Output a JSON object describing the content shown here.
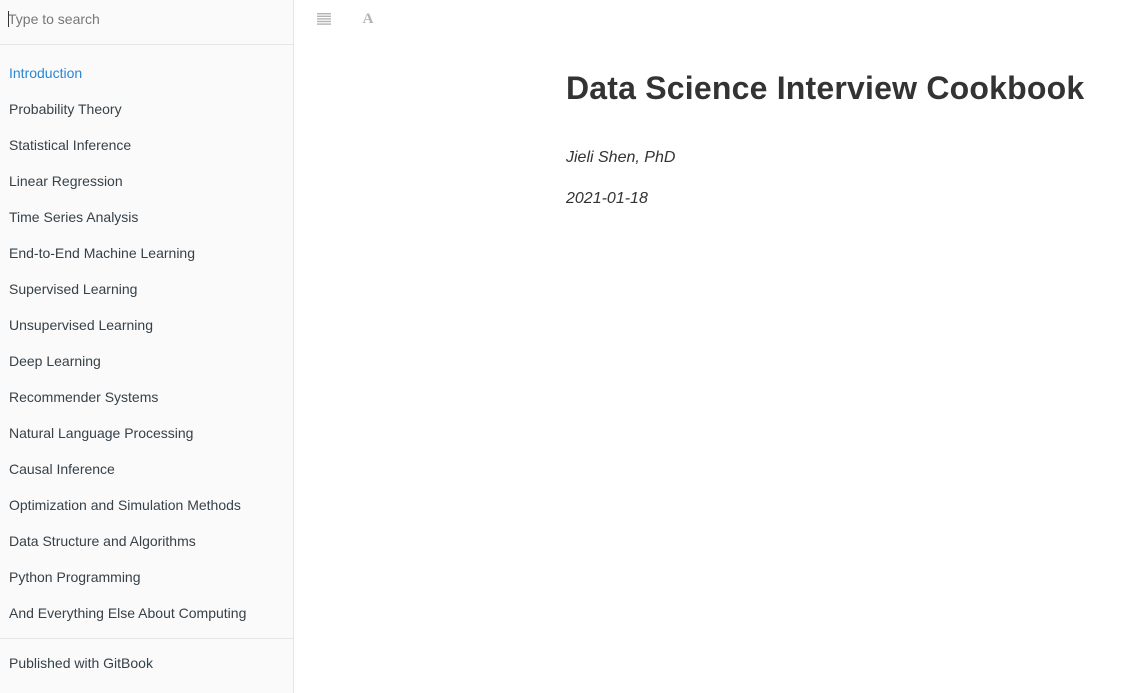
{
  "search": {
    "placeholder": "Type to search"
  },
  "sidebar": {
    "items": [
      {
        "label": "Introduction",
        "active": true
      },
      {
        "label": "Probability Theory"
      },
      {
        "label": "Statistical Inference"
      },
      {
        "label": "Linear Regression"
      },
      {
        "label": "Time Series Analysis"
      },
      {
        "label": "End-to-End Machine Learning"
      },
      {
        "label": "Supervised Learning"
      },
      {
        "label": "Unsupervised Learning"
      },
      {
        "label": "Deep Learning"
      },
      {
        "label": "Recommender Systems"
      },
      {
        "label": "Natural Language Processing"
      },
      {
        "label": "Causal Inference"
      },
      {
        "label": "Optimization and Simulation Methods"
      },
      {
        "label": "Data Structure and Algorithms"
      },
      {
        "label": "Python Programming"
      },
      {
        "label": "And Everything Else About Computing"
      }
    ],
    "footer_label": "Published with GitBook"
  },
  "toolbar": {
    "toggle_icon": "menu-lines-icon",
    "font_icon": "font-settings-icon",
    "font_glyph": "A"
  },
  "book": {
    "title": "Data Science Interview Cookbook",
    "author": "Jieli Shen, PhD",
    "date": "2021-01-18"
  },
  "colors": {
    "active_link": "#2b86d6",
    "text": "#364149",
    "sidebar_bg": "#fafafa",
    "icon": "#b3b3b3"
  }
}
